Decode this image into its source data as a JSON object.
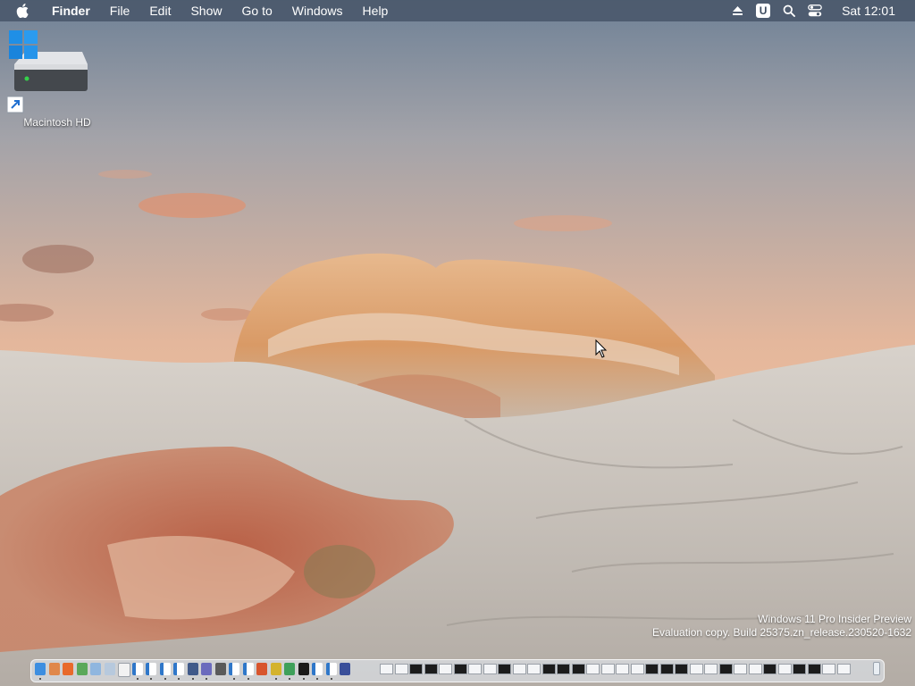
{
  "menubar": {
    "app_name": "Finder",
    "menus": [
      "File",
      "Edit",
      "Show",
      "Go to",
      "Windows",
      "Help"
    ],
    "status_icons": [
      "eject-icon",
      "u-app-icon",
      "search-icon",
      "control-center-icon"
    ],
    "u_badge_text": "U",
    "clock": "Sat 12:01"
  },
  "desktop": {
    "icons": [
      {
        "label": "Macintosh HD",
        "icon": "hard-drive-icon",
        "overlays": [
          "windows-logo-icon",
          "shortcut-arrow-icon"
        ]
      }
    ]
  },
  "watermark": {
    "line1": "Windows 11 Pro Insider Preview",
    "line2": "Evaluation copy. Build 25375.zn_release.230520-1632"
  },
  "dock": {
    "apps": [
      {
        "name": "finder-icon",
        "color": "#3d8ee0"
      },
      {
        "name": "launchpad-icon",
        "color": "#e0874a"
      },
      {
        "name": "firefox-icon",
        "color": "#e86a2c"
      },
      {
        "name": "photos-icon",
        "color": "#5aa85a"
      },
      {
        "name": "notes-icon",
        "color": "#8fb6df"
      },
      {
        "name": "preview-icon",
        "color": "#b7c9dd"
      },
      {
        "name": "textedit-icon",
        "color": "#f2f2f2"
      },
      {
        "name": "window-icon",
        "color": "#2f77c9"
      },
      {
        "name": "window-icon",
        "color": "#2f77c9"
      },
      {
        "name": "window-icon",
        "color": "#2f77c9"
      },
      {
        "name": "window-icon",
        "color": "#2f77c9"
      },
      {
        "name": "user-icon",
        "color": "#405a8a"
      },
      {
        "name": "network-icon",
        "color": "#6b6bbd"
      },
      {
        "name": "terminal-icon",
        "color": "#5a5a5a"
      },
      {
        "name": "window-icon",
        "color": "#2f77c9"
      },
      {
        "name": "window-icon",
        "color": "#2f77c9"
      },
      {
        "name": "media-icon",
        "color": "#d8552d"
      },
      {
        "name": "yellow-app-icon",
        "color": "#d4b32e"
      },
      {
        "name": "green-app-icon",
        "color": "#3ea05a"
      },
      {
        "name": "black-window-icon",
        "color": "#1a1a1a"
      },
      {
        "name": "window-icon",
        "color": "#2f77c9"
      },
      {
        "name": "window-icon",
        "color": "#2f77c9"
      },
      {
        "name": "settings-icon",
        "color": "#3a4f9a"
      }
    ],
    "minimized_windows": 32,
    "trash_icon": "trash-icon"
  },
  "colors": {
    "menubar_bg": "#49576a",
    "sky_top": "#6f8196",
    "sky_horizon": "#f0bc95",
    "rock_light": "#c9c3bb",
    "rock_red": "#b8563a"
  }
}
